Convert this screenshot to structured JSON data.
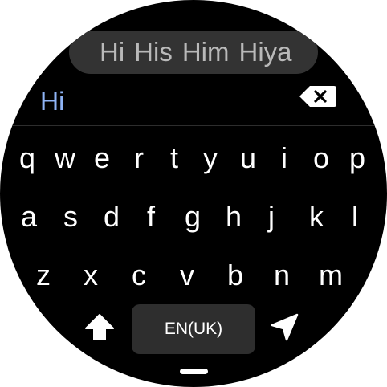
{
  "suggestions": [
    "Hi",
    "His",
    "Him",
    "Hiya"
  ],
  "input": {
    "text": "Hi"
  },
  "keyboard": {
    "row1": [
      "q",
      "w",
      "e",
      "r",
      "t",
      "y",
      "u",
      "i",
      "o",
      "p"
    ],
    "row2": [
      "a",
      "s",
      "d",
      "f",
      "g",
      "h",
      "j",
      "k",
      "l"
    ],
    "row3": [
      "z",
      "x",
      "c",
      "v",
      "b",
      "n",
      "m"
    ],
    "language_label": "EN(UK)"
  },
  "icons": {
    "backspace": "backspace-icon",
    "shift": "shift-icon",
    "send": "send-icon"
  },
  "colors": {
    "background": "#000000",
    "suggestion_pill": "#333333",
    "input_text": "#8fb4f6",
    "key_text": "#ffffff"
  }
}
